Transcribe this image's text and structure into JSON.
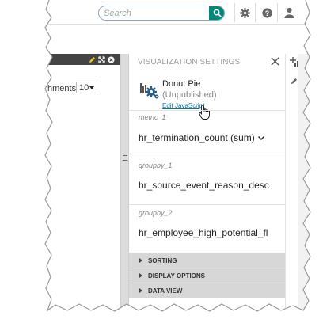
{
  "topbar": {
    "search_placeholder": "Search",
    "icons": [
      "search-icon",
      "gear-icon",
      "help-icon",
      "user-icon"
    ]
  },
  "left_panel": {
    "rows_label": "hments",
    "rows_value": "10"
  },
  "panel": {
    "title": "VISUALIZATION SETTINGS",
    "viz_name": "Donut Pie",
    "viz_status": "(Unpublished)",
    "edit_link": "Edit JavaScript",
    "fields": [
      {
        "label": "metric_1",
        "value": "hr_termination_count (sum)"
      },
      {
        "label": "groupby_1",
        "value": "hr_source_event_reason_desc"
      },
      {
        "label": "groupby_2",
        "value": "hr_employee_high_potential_fl"
      }
    ],
    "sections": [
      "SORTING",
      "DISPLAY OPTIONS",
      "DATA VIEW"
    ]
  },
  "colors": {
    "accent": "#00897b",
    "link": "#0077aa",
    "section_bg": "#d7d7d7",
    "dark_band": "#444444"
  }
}
